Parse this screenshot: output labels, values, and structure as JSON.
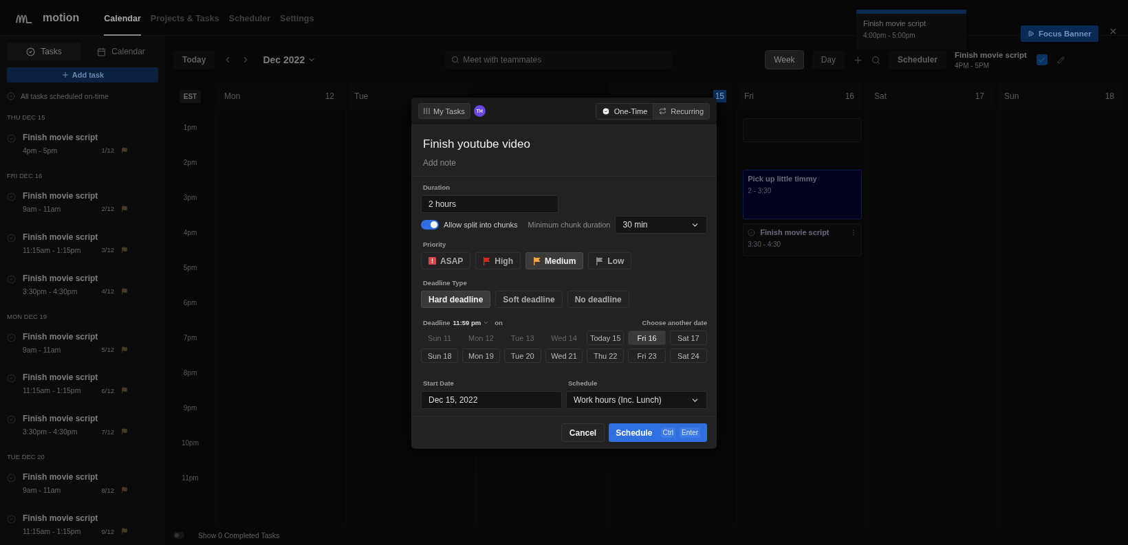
{
  "nav": {
    "logo": "motion",
    "items": [
      {
        "label": "Calendar",
        "selected": true
      },
      {
        "label": "Projects & Tasks",
        "selected": false
      },
      {
        "label": "Scheduler",
        "selected": false
      },
      {
        "label": "Settings",
        "selected": false
      }
    ]
  },
  "toast": {
    "title": "Finish movie script",
    "time": "4:00pm - 5:00pm",
    "button": "Focus Banner"
  },
  "sidebar": {
    "tabs": [
      {
        "label": "Tasks",
        "kind": "tasks",
        "selected": true
      },
      {
        "label": "Calendar",
        "kind": "calendar",
        "selected": false
      }
    ],
    "add_button": "Add task",
    "status": "All tasks scheduled on-time",
    "groups": [
      {
        "heading": "THU DEC 15",
        "tasks": [
          {
            "title": "Finish movie script",
            "time": "4pm - 5pm",
            "count": "1/12"
          }
        ]
      },
      {
        "heading": "FRI DEC 16",
        "tasks": [
          {
            "title": "Finish movie script",
            "time": "9am - 11am",
            "count": "2/12"
          },
          {
            "title": "Finish movie script",
            "time": "11:15am - 1:15pm",
            "count": "3/12"
          },
          {
            "title": "Finish movie script",
            "time": "3:30pm - 4:30pm",
            "count": "4/12"
          }
        ]
      },
      {
        "heading": "MON DEC 19",
        "tasks": [
          {
            "title": "Finish movie script",
            "time": "9am - 11am",
            "count": "5/12"
          },
          {
            "title": "Finish movie script",
            "time": "11:15am - 1:15pm",
            "count": "6/12"
          },
          {
            "title": "Finish movie script",
            "time": "3:30pm - 4:30pm",
            "count": "7/12"
          }
        ]
      },
      {
        "heading": "TUE DEC 20",
        "tasks": [
          {
            "title": "Finish movie script",
            "time": "9am - 11am",
            "count": "8/12"
          },
          {
            "title": "Finish movie script",
            "time": "11:15am - 1:15pm",
            "count": "9/12"
          }
        ]
      }
    ]
  },
  "toolbar": {
    "today": "Today",
    "month": "Dec 2022",
    "search": {
      "placeholder": "Meet with teammates"
    },
    "views": [
      {
        "label": "Week",
        "selected": true
      },
      {
        "label": "Day",
        "selected": false
      }
    ],
    "scheduler": "Scheduler",
    "current_task": {
      "title": "Finish movie script",
      "time": "4PM - 5PM",
      "checked": true
    }
  },
  "calendar": {
    "timezone": "EST",
    "days": [
      {
        "name": "Mon",
        "date": "12",
        "kind": "day"
      },
      {
        "name": "Tue"
      },
      {
        "date": "15",
        "kind": "today"
      },
      {
        "name": "Fri",
        "date": "16",
        "kind": "day"
      },
      {
        "name": "Sat",
        "date": "17",
        "kind": "day"
      },
      {
        "name": "Sun",
        "date": "18",
        "kind": "day"
      }
    ],
    "hours": [
      "1pm",
      "2pm",
      "3pm",
      "4pm",
      "5pm",
      "6pm",
      "7pm",
      "8pm",
      "9pm",
      "10pm",
      "11pm"
    ],
    "events": [
      {
        "kind": "blank"
      },
      {
        "kind": "event",
        "title": "Pick up little timmy",
        "time": "2 - 3:30"
      },
      {
        "kind": "task",
        "title": "Finish movie script",
        "time": "3:30 - 4:30"
      }
    ],
    "completed": {
      "label": "Show 0 Completed Tasks",
      "on": false
    }
  },
  "modal": {
    "list_button": "My Tasks",
    "avatar": "TH",
    "types": [
      {
        "label": "One-Time",
        "kind": "once",
        "selected": true
      },
      {
        "label": "Recurring",
        "kind": "repeat",
        "selected": false
      }
    ],
    "title": "Finish youtube video",
    "note": {
      "placeholder": "Add note"
    },
    "duration": {
      "label": "Duration",
      "value": "2 hours"
    },
    "split": {
      "label": "Allow split into chunks",
      "on": true
    },
    "chunk": {
      "label": "Minimum chunk duration",
      "value": "30 min"
    },
    "priority": {
      "label": "Priority",
      "options": [
        {
          "label": "ASAP",
          "kind": "asap",
          "selected": false
        },
        {
          "label": "High",
          "kind": "high",
          "selected": false
        },
        {
          "label": "Medium",
          "kind": "medium",
          "selected": true
        },
        {
          "label": "Low",
          "kind": "low",
          "selected": false
        }
      ]
    },
    "deadline_type": {
      "label": "Deadline Type",
      "options": [
        {
          "label": "Hard deadline",
          "selected": true
        },
        {
          "label": "Soft deadline",
          "selected": false
        },
        {
          "label": "No deadline",
          "selected": false
        }
      ]
    },
    "deadline": {
      "label": "Deadline",
      "time": "11:59 pm",
      "on": "on",
      "other": "Choose another date",
      "dates": [
        {
          "label": "Sun 11",
          "disabled": true,
          "selected": false
        },
        {
          "label": "Mon 12",
          "disabled": true,
          "selected": false
        },
        {
          "label": "Tue 13",
          "disabled": true,
          "selected": false
        },
        {
          "label": "Wed 14",
          "disabled": true,
          "selected": false
        },
        {
          "label": "Today 15",
          "disabled": false,
          "selected": false
        },
        {
          "label": "Fri 16",
          "disabled": false,
          "selected": true
        },
        {
          "label": "Sat 17",
          "disabled": false,
          "selected": false
        },
        {
          "label": "Sun 18",
          "disabled": false,
          "selected": false
        },
        {
          "label": "Mon 19",
          "disabled": false,
          "selected": false
        },
        {
          "label": "Tue 20",
          "disabled": false,
          "selected": false
        },
        {
          "label": "Wed 21",
          "disabled": false,
          "selected": false
        },
        {
          "label": "Thu 22",
          "disabled": false,
          "selected": false
        },
        {
          "label": "Fri 23",
          "disabled": false,
          "selected": false
        },
        {
          "label": "Sat 24",
          "disabled": false,
          "selected": false
        }
      ]
    },
    "start_date": {
      "label": "Start Date",
      "value": "Dec 15, 2022"
    },
    "schedule": {
      "label": "Schedule",
      "value": "Work hours (Inc. Lunch)"
    },
    "cancel": "Cancel",
    "submit": {
      "label": "Schedule",
      "keys": [
        "Ctrl",
        "Enter"
      ]
    }
  }
}
